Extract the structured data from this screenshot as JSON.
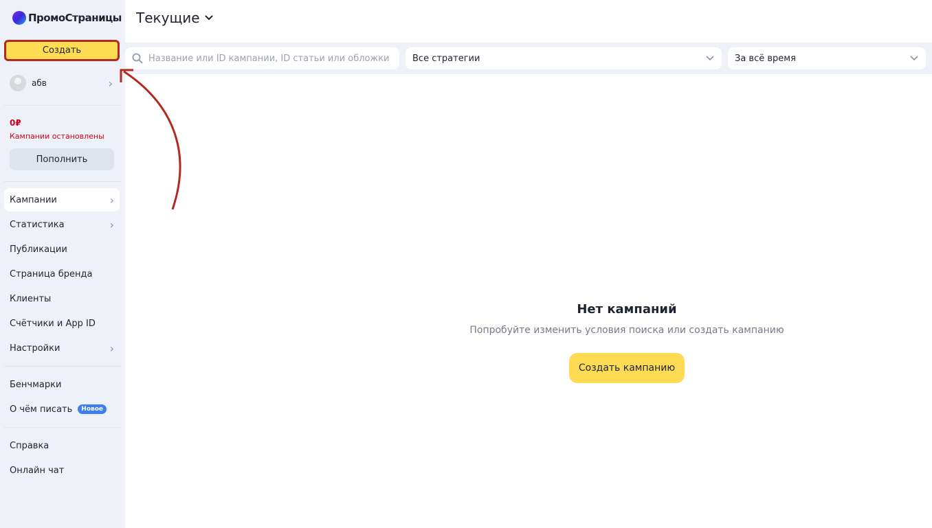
{
  "sidebar": {
    "logo": "ПромоСтраницы",
    "create_label": "Создать",
    "user": "абв",
    "balance": "0₽",
    "status": "Кампании остановлены",
    "topup_label": "Пополнить",
    "nav": [
      {
        "label": "Кампании"
      },
      {
        "label": "Статистика"
      },
      {
        "label": "Публикации"
      },
      {
        "label": "Страница бренда"
      },
      {
        "label": "Клиенты"
      },
      {
        "label": "Счётчики и App ID"
      },
      {
        "label": "Настройки"
      }
    ],
    "extra": [
      {
        "label": "Бенчмарки"
      },
      {
        "label": "О чём писать",
        "badge": "Новое"
      }
    ],
    "help": [
      {
        "label": "Справка"
      },
      {
        "label": "Онлайн чат"
      }
    ]
  },
  "main": {
    "title": "Текущие",
    "search_placeholder": "Название или ID кампании, ID статьи или обложки",
    "strategy": "Все стратегии",
    "period": "За всё время",
    "empty_title": "Нет кампаний",
    "empty_text": "Попробуйте изменить условия поиска или создать кампанию",
    "create_campaign_label": "Создать кампанию"
  }
}
